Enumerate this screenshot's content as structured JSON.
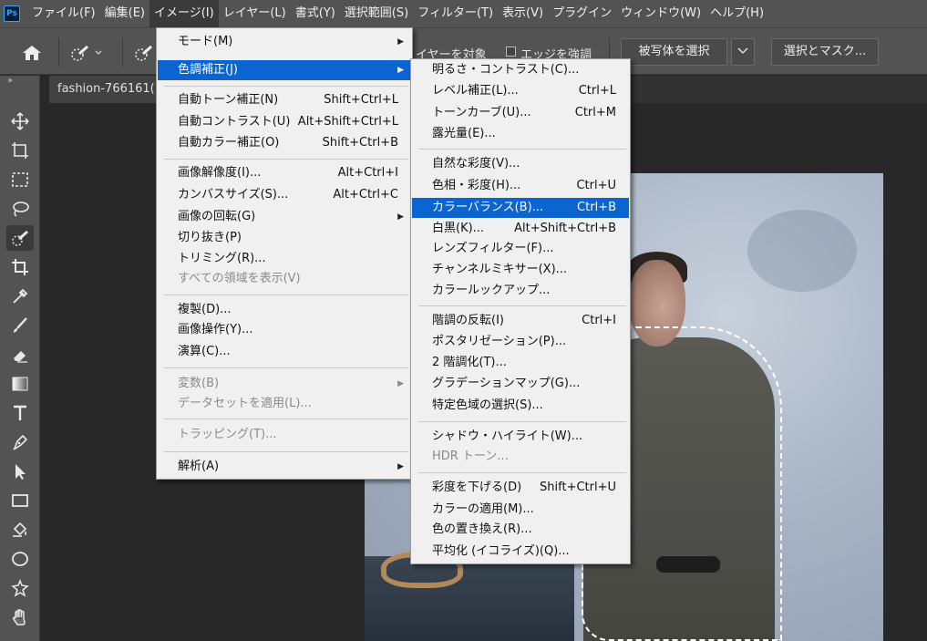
{
  "app": {
    "logo_text": "Ps"
  },
  "menubar": {
    "items": [
      "ファイル(F)",
      "編集(E)",
      "イメージ(I)",
      "レイヤー(L)",
      "書式(Y)",
      "選択範囲(S)",
      "フィルター(T)",
      "表示(V)",
      "プラグイン",
      "ウィンドウ(W)",
      "ヘルプ(H)"
    ],
    "active_index": 2
  },
  "options_bar": {
    "home_icon": "home-icon",
    "layer_target_text": "イヤーを対象",
    "edge_enhance_label": "エッジを強調",
    "select_subject_label": "被写体を選択",
    "select_mask_label": "選択とマスク..."
  },
  "document": {
    "tab_title": "fashion-766161("
  },
  "image_menu": {
    "items": [
      {
        "label": "モード(M)",
        "shortcut": "",
        "submenu": true,
        "disabled": false,
        "highlighted": false
      },
      {
        "label": "色調補正(J)",
        "shortcut": "",
        "submenu": true,
        "disabled": false,
        "highlighted": true
      },
      {
        "label": "自動トーン補正(N)",
        "shortcut": "Shift+Ctrl+L",
        "submenu": false,
        "disabled": false,
        "highlighted": false
      },
      {
        "label": "自動コントラスト(U)",
        "shortcut": "Alt+Shift+Ctrl+L",
        "submenu": false,
        "disabled": false,
        "highlighted": false
      },
      {
        "label": "自動カラー補正(O)",
        "shortcut": "Shift+Ctrl+B",
        "submenu": false,
        "disabled": false,
        "highlighted": false
      },
      {
        "label": "画像解像度(I)...",
        "shortcut": "Alt+Ctrl+I",
        "submenu": false,
        "disabled": false,
        "highlighted": false
      },
      {
        "label": "カンバスサイズ(S)...",
        "shortcut": "Alt+Ctrl+C",
        "submenu": false,
        "disabled": false,
        "highlighted": false
      },
      {
        "label": "画像の回転(G)",
        "shortcut": "",
        "submenu": true,
        "disabled": false,
        "highlighted": false
      },
      {
        "label": "切り抜き(P)",
        "shortcut": "",
        "submenu": false,
        "disabled": false,
        "highlighted": false
      },
      {
        "label": "トリミング(R)...",
        "shortcut": "",
        "submenu": false,
        "disabled": false,
        "highlighted": false
      },
      {
        "label": "すべての領域を表示(V)",
        "shortcut": "",
        "submenu": false,
        "disabled": true,
        "highlighted": false
      },
      {
        "label": "複製(D)...",
        "shortcut": "",
        "submenu": false,
        "disabled": false,
        "highlighted": false
      },
      {
        "label": "画像操作(Y)...",
        "shortcut": "",
        "submenu": false,
        "disabled": false,
        "highlighted": false
      },
      {
        "label": "演算(C)...",
        "shortcut": "",
        "submenu": false,
        "disabled": false,
        "highlighted": false
      },
      {
        "label": "変数(B)",
        "shortcut": "",
        "submenu": true,
        "disabled": true,
        "highlighted": false
      },
      {
        "label": "データセットを適用(L)...",
        "shortcut": "",
        "submenu": false,
        "disabled": true,
        "highlighted": false
      },
      {
        "label": "トラッピング(T)...",
        "shortcut": "",
        "submenu": false,
        "disabled": true,
        "highlighted": false
      },
      {
        "label": "解析(A)",
        "shortcut": "",
        "submenu": true,
        "disabled": false,
        "highlighted": false
      }
    ]
  },
  "adjustments_menu": {
    "items": [
      {
        "label": "明るさ・コントラスト(C)...",
        "shortcut": "",
        "disabled": false,
        "highlighted": false
      },
      {
        "label": "レベル補正(L)...",
        "shortcut": "Ctrl+L",
        "disabled": false,
        "highlighted": false
      },
      {
        "label": "トーンカーブ(U)...",
        "shortcut": "Ctrl+M",
        "disabled": false,
        "highlighted": false
      },
      {
        "label": "露光量(E)...",
        "shortcut": "",
        "disabled": false,
        "highlighted": false
      },
      {
        "label": "自然な彩度(V)...",
        "shortcut": "",
        "disabled": false,
        "highlighted": false
      },
      {
        "label": "色相・彩度(H)...",
        "shortcut": "Ctrl+U",
        "disabled": false,
        "highlighted": false
      },
      {
        "label": "カラーバランス(B)...",
        "shortcut": "Ctrl+B",
        "disabled": false,
        "highlighted": true
      },
      {
        "label": "白黒(K)...",
        "shortcut": "Alt+Shift+Ctrl+B",
        "disabled": false,
        "highlighted": false
      },
      {
        "label": "レンズフィルター(F)...",
        "shortcut": "",
        "disabled": false,
        "highlighted": false
      },
      {
        "label": "チャンネルミキサー(X)...",
        "shortcut": "",
        "disabled": false,
        "highlighted": false
      },
      {
        "label": "カラールックアップ...",
        "shortcut": "",
        "disabled": false,
        "highlighted": false
      },
      {
        "label": "階調の反転(I)",
        "shortcut": "Ctrl+I",
        "disabled": false,
        "highlighted": false
      },
      {
        "label": "ポスタリゼーション(P)...",
        "shortcut": "",
        "disabled": false,
        "highlighted": false
      },
      {
        "label": "2 階調化(T)...",
        "shortcut": "",
        "disabled": false,
        "highlighted": false
      },
      {
        "label": "グラデーションマップ(G)...",
        "shortcut": "",
        "disabled": false,
        "highlighted": false
      },
      {
        "label": "特定色域の選択(S)...",
        "shortcut": "",
        "disabled": false,
        "highlighted": false
      },
      {
        "label": "シャドウ・ハイライト(W)...",
        "shortcut": "",
        "disabled": false,
        "highlighted": false
      },
      {
        "label": "HDR トーン...",
        "shortcut": "",
        "disabled": true,
        "highlighted": false
      },
      {
        "label": "彩度を下げる(D)",
        "shortcut": "Shift+Ctrl+U",
        "disabled": false,
        "highlighted": false
      },
      {
        "label": "カラーの適用(M)...",
        "shortcut": "",
        "disabled": false,
        "highlighted": false
      },
      {
        "label": "色の置き換え(R)...",
        "shortcut": "",
        "disabled": false,
        "highlighted": false
      },
      {
        "label": "平均化 (イコライズ)(Q)...",
        "shortcut": "",
        "disabled": false,
        "highlighted": false
      }
    ]
  },
  "toolbar": {
    "tools": [
      "move-tool",
      "artboard-tool",
      "marquee-tool",
      "lasso-tool",
      "quick-selection-tool",
      "crop-tool",
      "eyedropper-tool",
      "brush-tool",
      "eraser-tool",
      "gradient-tool",
      "type-tool",
      "pen-tool",
      "path-selection-tool",
      "rectangle-tool",
      "paint-bucket-tool",
      "ellipse-tool",
      "custom-shape-tool",
      "hand-tool"
    ],
    "active_tool": "quick-selection-tool"
  },
  "colors": {
    "highlight": "#0a64d2",
    "panel": "#535353",
    "workspace": "#282828",
    "menu_bg": "#f0f0f0"
  }
}
